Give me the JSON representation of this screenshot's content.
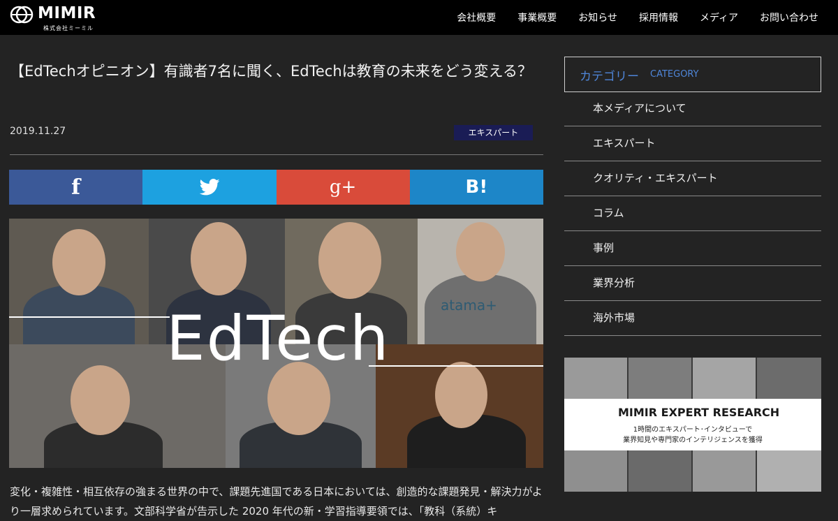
{
  "site": {
    "logo_text": "MIMIR",
    "logo_sub": "株式会社ミーミル"
  },
  "nav": [
    "会社概要",
    "事業概要",
    "お知らせ",
    "採用情報",
    "メディア",
    "お問い合わせ"
  ],
  "article": {
    "title": "【EdTechオピニオン】有識者7名に聞く、EdTechは教育の未来をどう変える？",
    "date": "2019.11.27",
    "tag": "エキスパート",
    "hero_word": "EdTech",
    "hero_shirt_text": "atama+",
    "body": "変化・複雑性・相互依存の強まる世界の中で、課題先進国である日本においては、創造的な課題発見・解決力がより一層求められています。文部科学省が告示した 2020 年代の新・学習指導要領では、「教科（系統）キ"
  },
  "share": {
    "facebook": "f",
    "googleplus": "g+",
    "hatena": "B!"
  },
  "sidebar": {
    "category_title": "カテゴリー",
    "category_sub": "CATEGORY",
    "items": [
      "本メディアについて",
      "エキスパート",
      "クオリティ・エキスパート",
      "コラム",
      "事例",
      "業界分析",
      "海外市場"
    ]
  },
  "banner": {
    "logo": "MIMIR EXPERT RESEARCH",
    "line1": "1時間のエキスパート･インタビューで",
    "line2": "業界知見や専門家のインテリジェンスを獲得"
  }
}
